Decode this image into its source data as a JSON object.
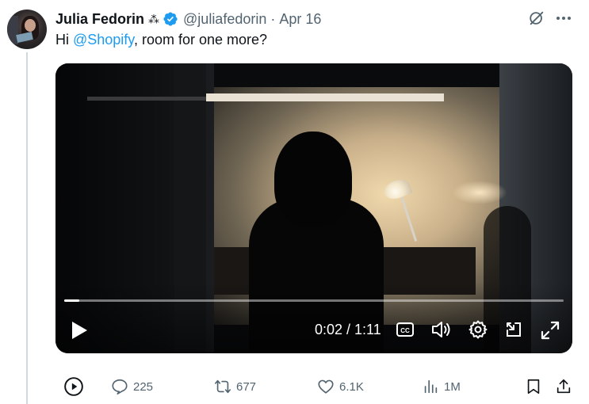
{
  "tweet": {
    "display_name": "Julia Fedorin",
    "name_emoji": "⁂",
    "handle": "@juliafedorin",
    "separator": "·",
    "date": "Apr 16",
    "text_prefix": "Hi ",
    "mention": "@Shopify",
    "text_suffix": ", room for one more?"
  },
  "video": {
    "time": "0:02 / 1:11",
    "progress": 0.03,
    "cc_label": "CC"
  },
  "actions": {
    "replies": "225",
    "reposts": "677",
    "likes": "6.1K",
    "views": "1M"
  },
  "colors": {
    "accent": "#1d9bf0",
    "text_primary": "#0f1419",
    "text_secondary": "#536471"
  },
  "icons": {
    "verified": "verified-badge-icon",
    "grok": "grok-icon",
    "more": "more-icon",
    "play": "play-icon",
    "cc": "cc-icon",
    "volume": "volume-icon",
    "settings": "gear-icon",
    "pip": "picture-in-picture-icon",
    "fullscreen": "fullscreen-icon",
    "replay": "play-circle-icon",
    "reply": "reply-icon",
    "repost": "repost-icon",
    "like": "heart-icon",
    "views": "views-icon",
    "bookmark": "bookmark-icon",
    "share": "share-icon"
  }
}
